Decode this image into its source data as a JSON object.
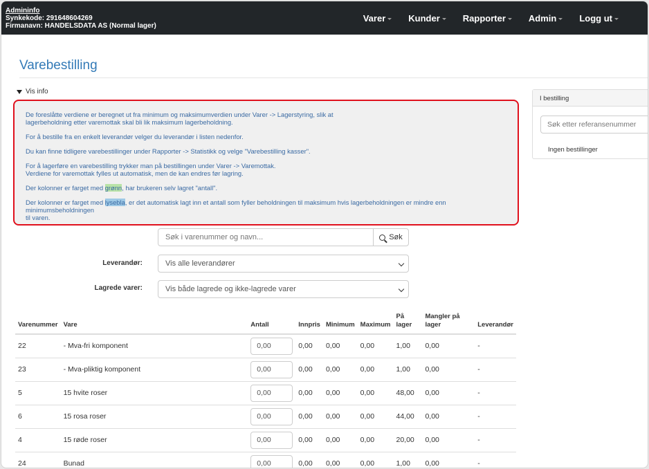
{
  "navbar": {
    "user_link": "Admininfo",
    "sync_code": "Synkekode: 291648604269",
    "company": "Firmanavn: HANDELSDATA AS (Normal lager)",
    "menu": [
      {
        "label": "Varer"
      },
      {
        "label": "Kunder"
      },
      {
        "label": "Rapporter"
      },
      {
        "label": "Admin"
      },
      {
        "label": "Logg ut"
      }
    ]
  },
  "page": {
    "title": "Varebestilling",
    "toggle_label": "Vis info"
  },
  "info": {
    "p1a": "De foreslåtte verdiene er beregnet ut fra minimum og maksimumverdien under Varer -> Lagerstyring, slik at",
    "p1b": "lagerbeholdning etter varemottak skal bli lik maksimum lagerbeholdning.",
    "p2": "For å bestille fra en enkelt leverandør velger du leverandør i listen nedenfor.",
    "p3": "Du kan finne tidligere varebestillinger under Rapporter -> Statistikk og velge \"Varebestilling kasser\".",
    "p4a": "For å lagerføre en varebestilling trykker man på bestillingen under Varer -> Varemottak.",
    "p4b": "Verdiene for varemottak fylles ut automatisk, men de kan endres før lagring.",
    "p5_pre": "Der kolonner er farget med ",
    "p5_hl": "grønn",
    "p5_post": ", har brukeren selv lagret \"antall\".",
    "p6_pre": "Der kolonner er farget med ",
    "p6_hl": "lysebla",
    "p6_post": ", er det automatisk lagt inn et antall som fyller beholdningen til maksimum hvis lagerbeholdningen er mindre enn minimumsbeholdningen",
    "p6_end": "til varen."
  },
  "side_panel": {
    "header": "I bestilling",
    "search_placeholder": "Søk etter referansenummer",
    "empty_text": "Ingen bestillinger"
  },
  "search": {
    "placeholder": "Søk i varenummer og navn...",
    "button_label": "Søk"
  },
  "filters": {
    "supplier_label": "Leverandør:",
    "supplier_value": "Vis alle leverandører",
    "saved_label": "Lagrede varer:",
    "saved_value": "Vis både lagrede og ikke-lagrede varer"
  },
  "table": {
    "headers": {
      "varenummer": "Varenummer",
      "vare": "Vare",
      "antall": "Antall",
      "innpris": "Innpris",
      "minimum": "Minimum",
      "maximum": "Maximum",
      "pa_lager_1": "På",
      "pa_lager_2": "lager",
      "mangler_1": "Mangler på",
      "mangler_2": "lager",
      "leverandor": "Leverandør"
    },
    "rows": [
      {
        "nr": "22",
        "vare": "- Mva-fri komponent",
        "antall": "0,00",
        "innpris": "0,00",
        "min": "0,00",
        "max": "0,00",
        "lager": "1,00",
        "mangler": "0,00",
        "lev": "-"
      },
      {
        "nr": "23",
        "vare": "- Mva-pliktig komponent",
        "antall": "0,00",
        "innpris": "0,00",
        "min": "0,00",
        "max": "0,00",
        "lager": "1,00",
        "mangler": "0,00",
        "lev": "-"
      },
      {
        "nr": "5",
        "vare": "15 hvite roser",
        "antall": "0,00",
        "innpris": "0,00",
        "min": "0,00",
        "max": "0,00",
        "lager": "48,00",
        "mangler": "0,00",
        "lev": "-"
      },
      {
        "nr": "6",
        "vare": "15 rosa roser",
        "antall": "0,00",
        "innpris": "0,00",
        "min": "0,00",
        "max": "0,00",
        "lager": "44,00",
        "mangler": "0,00",
        "lev": "-"
      },
      {
        "nr": "4",
        "vare": "15 røde roser",
        "antall": "0,00",
        "innpris": "0,00",
        "min": "0,00",
        "max": "0,00",
        "lager": "20,00",
        "mangler": "0,00",
        "lev": "-"
      },
      {
        "nr": "24",
        "vare": "Bunad",
        "antall": "0,00",
        "innpris": "0,00",
        "min": "0,00",
        "max": "0,00",
        "lager": "1,00",
        "mangler": "0,00",
        "lev": "-"
      }
    ]
  }
}
